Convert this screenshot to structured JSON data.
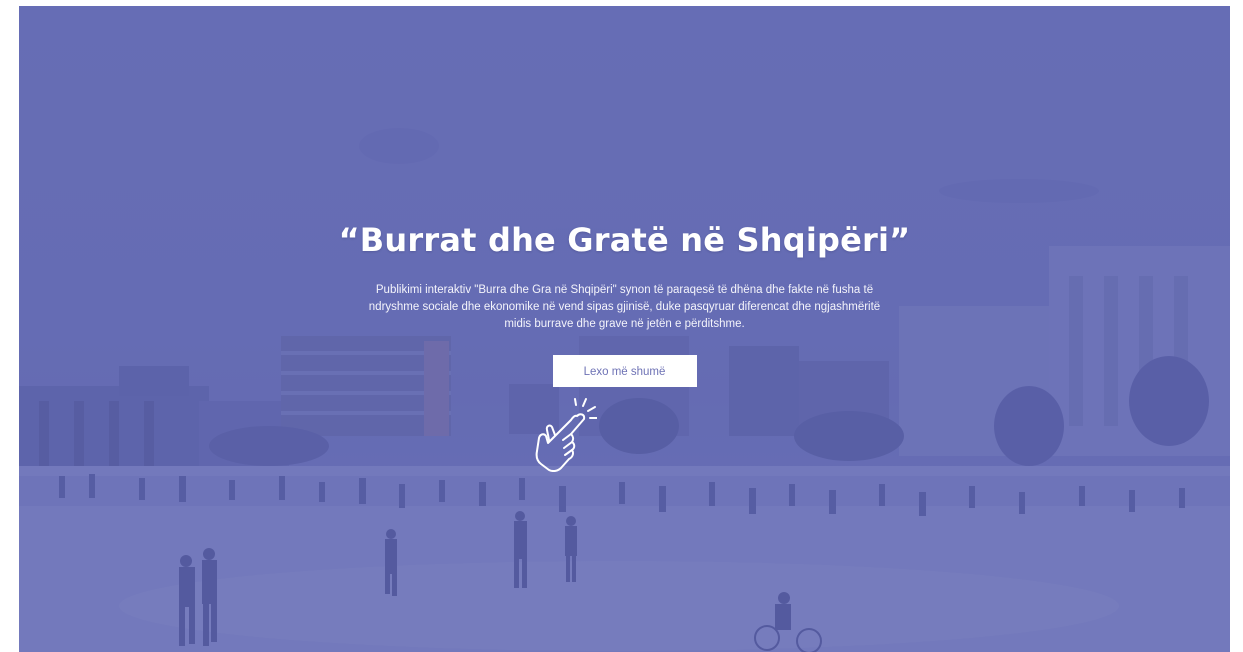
{
  "hero": {
    "title": "“Burrat dhe Gratë në Shqipëri”",
    "description": "Publikimi interaktiv \"Burra dhe Gra në Shqipëri\" synon të paraqesë të dhëna dhe fakte në fusha të ndryshme sociale dhe ekonomike në vend sipas gjinisë, duke pasqyruar diferencat dhe ngjashmëritë midis burrave dhe grave në jetën e përditshme.",
    "cta_label": "Lexo më shumë",
    "cta_icon": "tap-hand-icon"
  },
  "colors": {
    "overlay": "#6067b2",
    "text": "#ffffff",
    "cta_background": "#ffffff",
    "cta_text": "#6e72b5"
  }
}
